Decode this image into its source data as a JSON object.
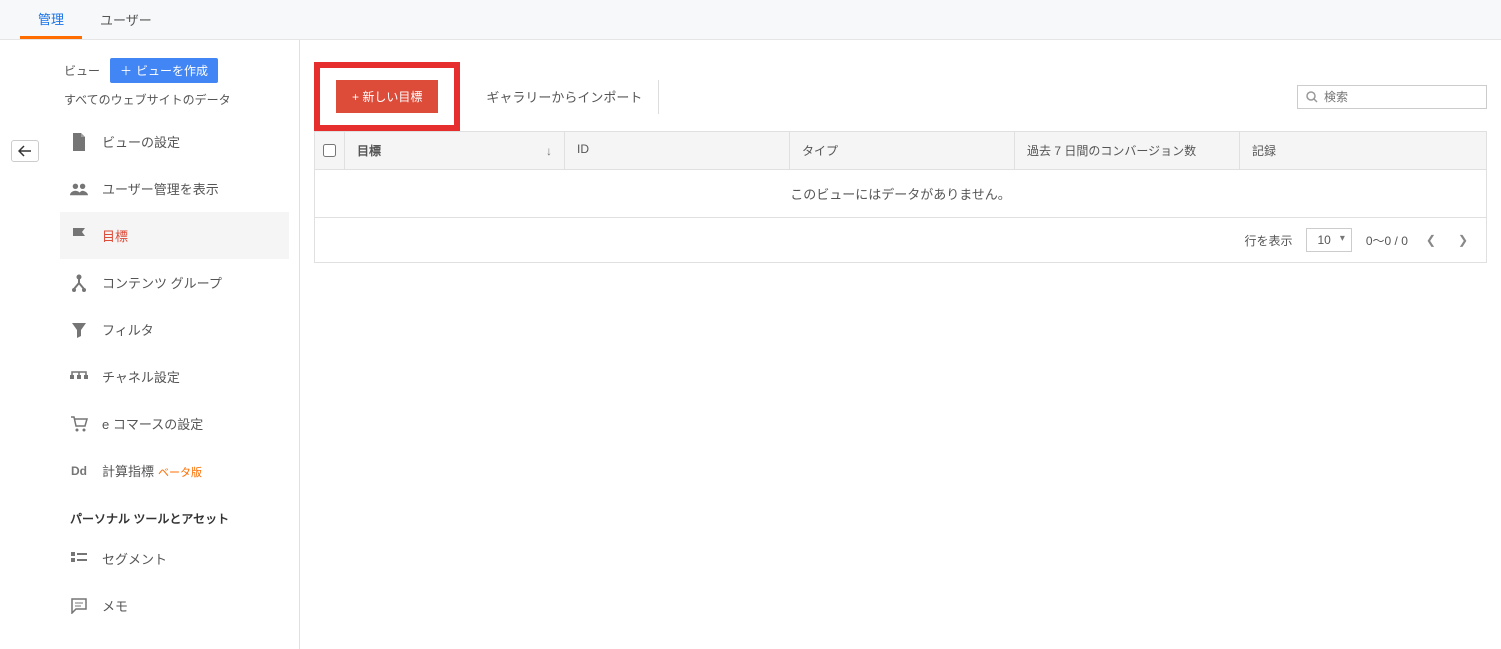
{
  "tabs": {
    "admin": "管理",
    "user": "ユーザー"
  },
  "sidebar": {
    "view_label": "ビュー",
    "create_view_btn": "ビューを作成",
    "all_data": "すべてのウェブサイトのデータ",
    "items": [
      {
        "label": "ビューの設定"
      },
      {
        "label": "ユーザー管理を表示"
      },
      {
        "label": "目標"
      },
      {
        "label": "コンテンツ グループ"
      },
      {
        "label": "フィルタ"
      },
      {
        "label": "チャネル設定"
      },
      {
        "label": "e コマースの設定"
      },
      {
        "label": "計算指標",
        "beta": "ベータ版"
      }
    ],
    "section_title": "パーソナル ツールとアセット",
    "personal": [
      {
        "label": "セグメント"
      },
      {
        "label": "メモ"
      }
    ]
  },
  "toolbar": {
    "new_goal": "+ 新しい目標",
    "import_gallery": "ギャラリーからインポート",
    "search_placeholder": "検索"
  },
  "table": {
    "headers": {
      "goal": "目標",
      "id": "ID",
      "type": "タイプ",
      "conversions": "過去 7 日間のコンバージョン数",
      "record": "記録"
    },
    "empty": "このビューにはデータがありません。",
    "rows_label": "行を表示",
    "rows_value": "10",
    "range": "0～0 / 0"
  }
}
